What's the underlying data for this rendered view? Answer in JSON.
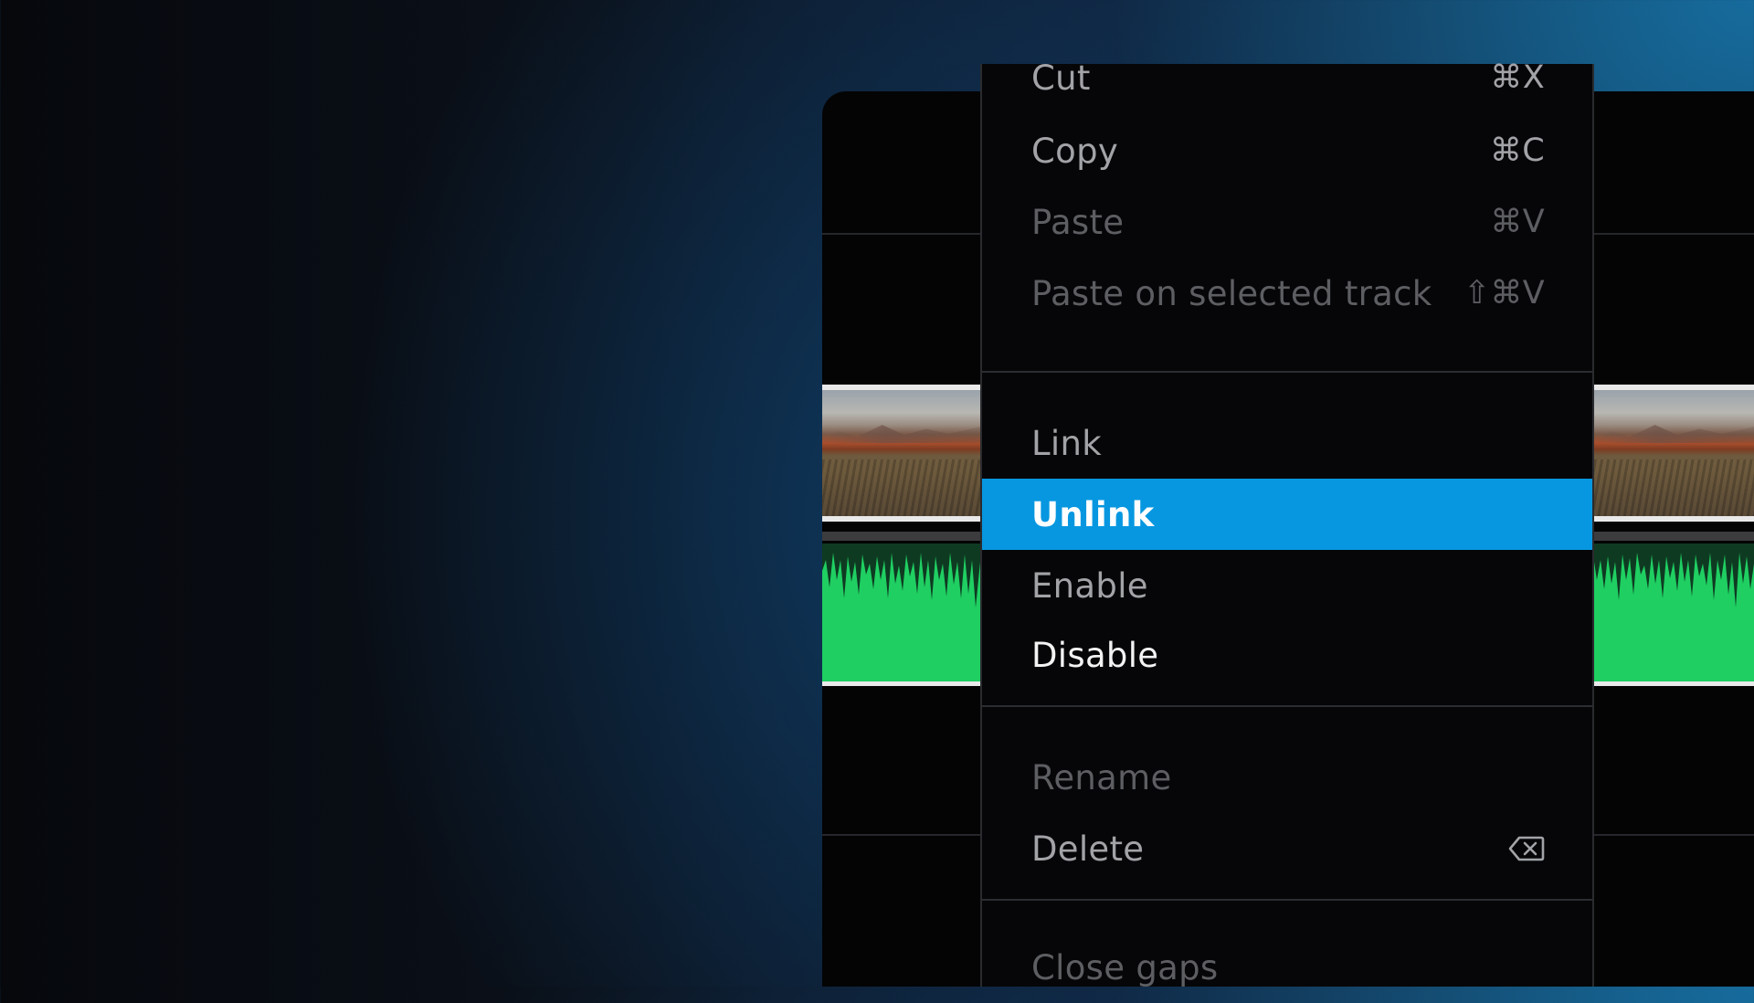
{
  "context_menu": {
    "groups": [
      {
        "items": [
          {
            "label": "Cut",
            "shortcut": "⌘X",
            "state": "enabled"
          },
          {
            "label": "Copy",
            "shortcut": "⌘C",
            "state": "enabled"
          },
          {
            "label": "Paste",
            "shortcut": "⌘V",
            "state": "disabled"
          },
          {
            "label": "Paste on selected track",
            "shortcut": "⇧⌘V",
            "state": "disabled"
          }
        ]
      },
      {
        "items": [
          {
            "label": "Link",
            "state": "enabled"
          },
          {
            "label": "Unlink",
            "state": "highlighted"
          },
          {
            "label": "Enable",
            "state": "enabled"
          },
          {
            "label": "Disable",
            "state": "enabled"
          }
        ]
      },
      {
        "items": [
          {
            "label": "Rename",
            "state": "disabled"
          },
          {
            "label": "Delete",
            "shortcut_icon": "backspace-icon",
            "state": "enabled"
          }
        ]
      },
      {
        "items": [
          {
            "label": "Close gaps",
            "state": "disabled"
          }
        ]
      }
    ]
  },
  "timeline": {
    "video_clip_icon": "landscape-thumbnail",
    "audio_clip_icon": "waveform"
  },
  "colors": {
    "highlight": "#0797E0",
    "audio_clip": "#1FCF62",
    "menu_background": "#060608"
  }
}
